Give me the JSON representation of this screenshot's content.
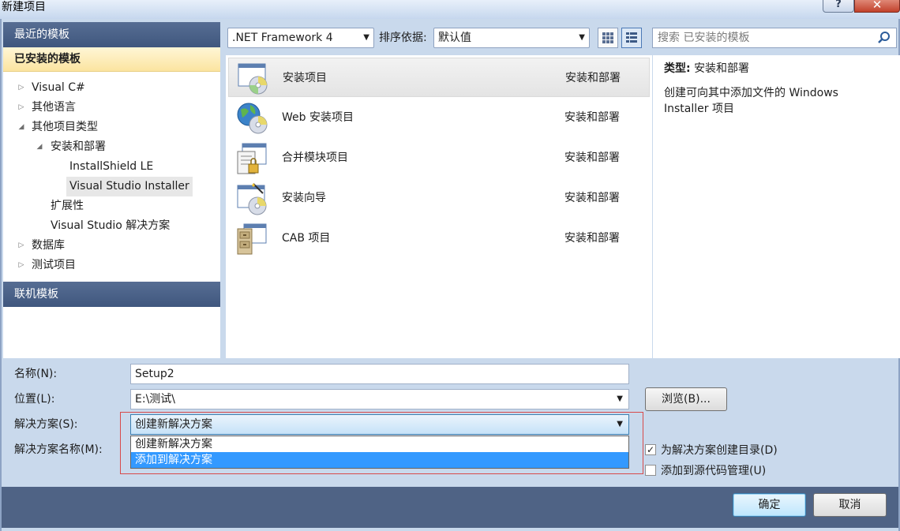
{
  "window": {
    "title": "新建项目",
    "help_label": "?",
    "close_label": "✕"
  },
  "left_pane": {
    "recent_header": "最近的模板",
    "installed_header": "已安装的模板",
    "online_header": "联机模板",
    "tree": [
      {
        "label": "Visual C#",
        "arrow": "▷"
      },
      {
        "label": "其他语言",
        "arrow": "▷"
      },
      {
        "label": "其他项目类型",
        "arrow": "◢"
      },
      {
        "label": "安装和部署",
        "arrow": "◢"
      },
      {
        "label": "InstallShield LE",
        "arrow": ""
      },
      {
        "label": "Visual Studio Installer",
        "arrow": ""
      },
      {
        "label": "扩展性",
        "arrow": ""
      },
      {
        "label": "Visual Studio 解决方案",
        "arrow": ""
      },
      {
        "label": "数据库",
        "arrow": "▷"
      },
      {
        "label": "测试项目",
        "arrow": "▷"
      }
    ]
  },
  "toolbar": {
    "framework": ".NET Framework 4",
    "sort_label": "排序依据:",
    "sort_value": "默认值",
    "search_placeholder": "搜索 已安装的模板"
  },
  "templates": [
    {
      "name": "安装项目",
      "category": "安装和部署",
      "icon": "setup-cd-icon"
    },
    {
      "name": "Web 安装项目",
      "category": "安装和部署",
      "icon": "web-setup-globe-icon"
    },
    {
      "name": "合并模块项目",
      "category": "安装和部署",
      "icon": "merge-module-icon"
    },
    {
      "name": "安装向导",
      "category": "安装和部署",
      "icon": "setup-wizard-icon"
    },
    {
      "name": "CAB 项目",
      "category": "安装和部署",
      "icon": "cab-cabinet-icon"
    }
  ],
  "description": {
    "type_label": "类型:",
    "type_value": "安装和部署",
    "text": "创建可向其中添加文件的 Windows Installer 项目"
  },
  "form": {
    "name_label": "名称(N):",
    "name_value": "Setup2",
    "location_label": "位置(L):",
    "location_value": "E:\\测试\\",
    "browse_label": "浏览(B)...",
    "solution_label": "解决方案(S):",
    "solution_value": "创建新解决方案",
    "solution_options": [
      "创建新解决方案",
      "添加到解决方案"
    ],
    "solution_name_label": "解决方案名称(M):",
    "create_dir_label": "为解决方案创建目录(D)",
    "create_dir_checked": true,
    "source_control_label": "添加到源代码管理(U)",
    "source_control_checked": false
  },
  "buttons": {
    "ok": "确定",
    "cancel": "取消"
  },
  "colors": {
    "header_blue": "#4a6189",
    "selection_blue": "#3399ff",
    "highlight_outline": "#d84a4a"
  }
}
